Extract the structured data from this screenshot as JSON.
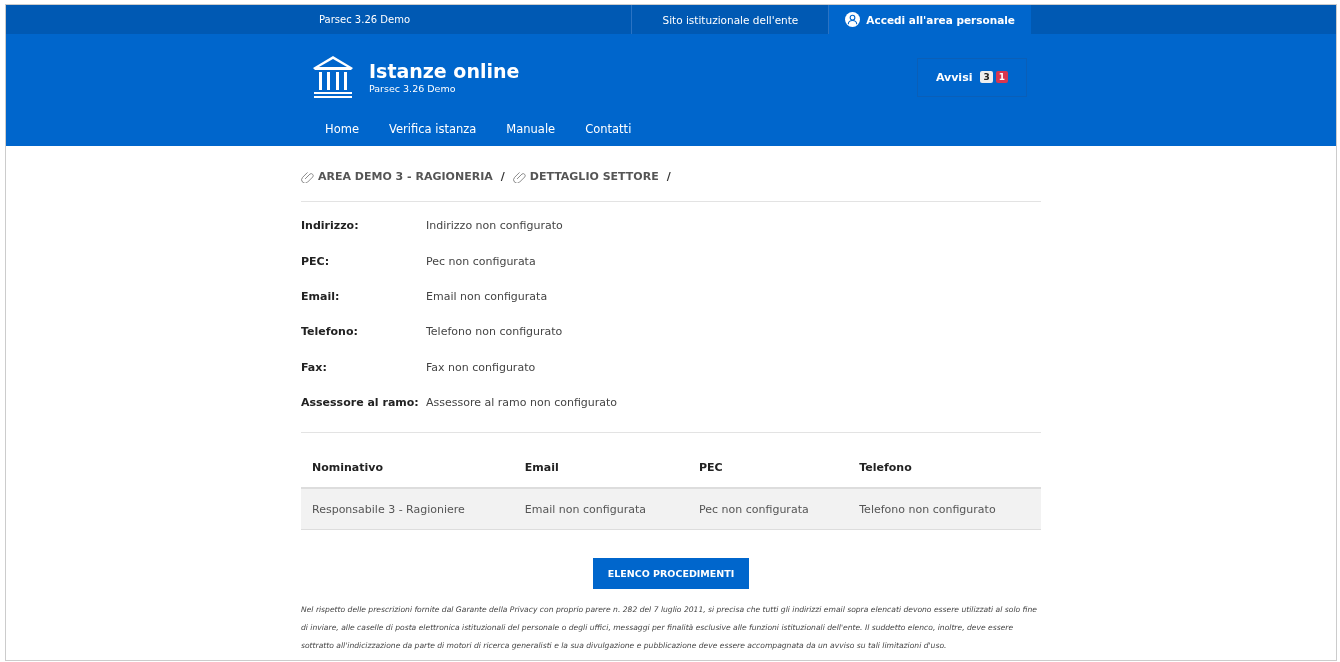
{
  "top_bar": {
    "brand": "Parsec 3.26 Demo",
    "links": [
      "Sito istituzionale dell'ente"
    ],
    "login": "Accedi all'area personale"
  },
  "header": {
    "title": "Istanze online",
    "subtitle": "Parsec 3.26 Demo",
    "notices": {
      "label": "Avvisi",
      "badges": [
        {
          "count": "3",
          "color": "#eeeeee"
        },
        {
          "count": "1",
          "color": "#d9364f"
        }
      ]
    }
  },
  "nav": [
    "Home",
    "Verifica istanza",
    "Manuale",
    "Contatti"
  ],
  "breadcrumb": [
    {
      "label": "AREA DEMO 3 - RAGIONERIA",
      "separator": "/"
    },
    {
      "label": "DETTAGLIO SETTORE",
      "separator": "/"
    }
  ],
  "details": [
    {
      "label": "Indirizzo:",
      "value": "Indirizzo non configurato"
    },
    {
      "label": "PEC:",
      "value": "Pec non configurata"
    },
    {
      "label": "Email:",
      "value": "Email non configurata"
    },
    {
      "label": "Telefono:",
      "value": "Telefono non configurato"
    },
    {
      "label": "Fax:",
      "value": "Fax non configurato"
    },
    {
      "label": "Assessore al ramo:",
      "value": "Assessore al ramo non configurato"
    }
  ],
  "table": {
    "columns": [
      "Nominativo",
      "Email",
      "PEC",
      "Telefono"
    ],
    "rows": [
      [
        "Responsabile 3 - Ragioniere",
        "Email non configurata",
        "Pec non configurata",
        "Telefono non configurato"
      ]
    ]
  },
  "button": "ELENCO PROCEDIMENTI",
  "disclaimer": "Nel rispetto delle prescrizioni fornite dal Garante della Privacy con proprio parere n. 282 del 7 luglio 2011, si precisa che tutti gli indirizzi email sopra elencati devono essere utilizzati al solo fine di inviare, alle caselle di posta elettronica istituzionali del personale o degli uffici, messaggi per finalità esclusive alle funzioni istituzionali dell'ente. Il suddetto elenco, inoltre, deve essere sottratto all'indicizzazione da parte di motori di ricerca generalisti e la sua divulgazione e pubblicazione deve essere accompagnata da un avviso su tali limitazioni d'uso."
}
